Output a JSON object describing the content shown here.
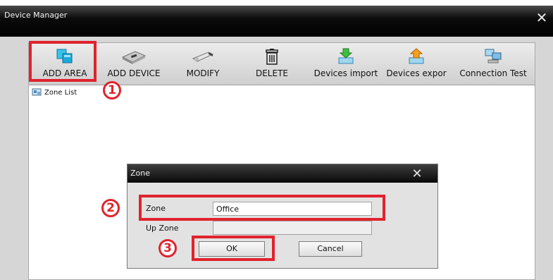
{
  "window": {
    "title": "Device Manager",
    "close_glyph": "✕"
  },
  "toolbar": {
    "buttons": [
      {
        "label": "ADD AREA",
        "icon": "add-area-icon"
      },
      {
        "label": "ADD DEVICE",
        "icon": "add-device-icon"
      },
      {
        "label": "MODIFY",
        "icon": "modify-icon"
      },
      {
        "label": "DELETE",
        "icon": "delete-icon"
      },
      {
        "label": "Devices import",
        "icon": "devices-import-icon"
      },
      {
        "label": "Devices expor",
        "icon": "devices-export-icon"
      },
      {
        "label": "Connection  Test",
        "icon": "connection-test-icon"
      }
    ]
  },
  "tree": {
    "root_label": "Zone List",
    "icon": "zone-list-icon"
  },
  "dialog": {
    "title": "Zone",
    "close_glyph": "✕",
    "zone_label": "Zone",
    "zone_value": "Office",
    "up_zone_label": "Up Zone",
    "up_zone_value": "",
    "ok_label": "OK",
    "cancel_label": "Cancel"
  },
  "annotations": {
    "step1": "1",
    "step2": "2",
    "step3": "3"
  },
  "colors": {
    "annotation_red": "#e0232d",
    "titlebar": "#000000"
  }
}
